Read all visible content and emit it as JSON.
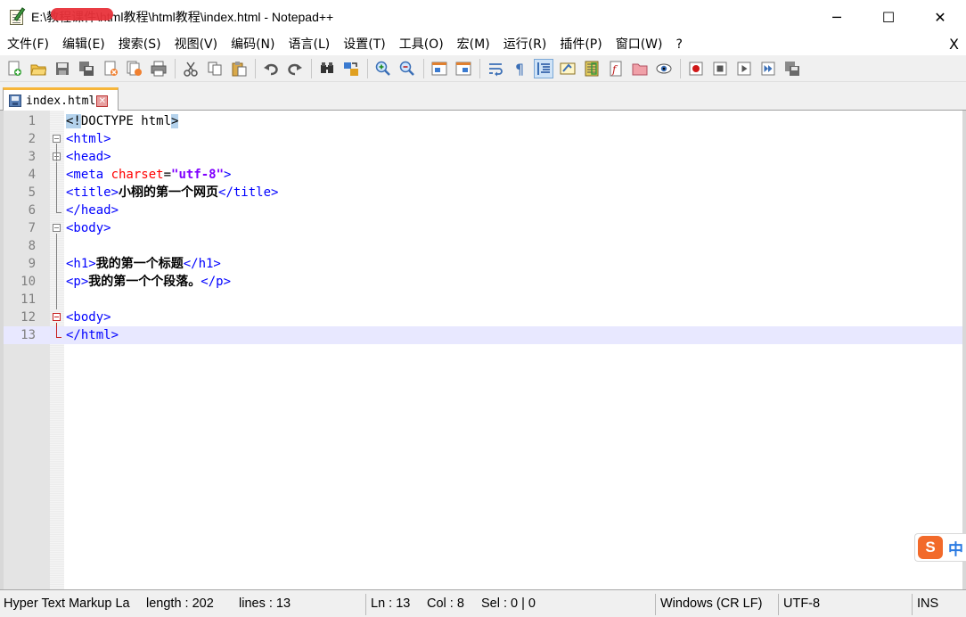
{
  "window": {
    "title": "E:\\教程课件\\html教程\\html教程\\index.html - Notepad++",
    "minimize": "─",
    "maximize": "☐",
    "close": "✕"
  },
  "menu": {
    "items": [
      "文件(F)",
      "编辑(E)",
      "搜索(S)",
      "视图(V)",
      "编码(N)",
      "语言(L)",
      "设置(T)",
      "工具(O)",
      "宏(M)",
      "运行(R)",
      "插件(P)",
      "窗口(W)",
      "?"
    ],
    "close": "X"
  },
  "tab": {
    "label": "index.html",
    "close": "✕"
  },
  "editor": {
    "lines": [
      {
        "n": "1",
        "tokens": [
          [
            "hl",
            "<!"
          ],
          [
            "plain",
            "DOCTYPE html"
          ],
          [
            "hl",
            ">"
          ]
        ]
      },
      {
        "n": "2",
        "tokens": [
          [
            "tag",
            "<html>"
          ]
        ]
      },
      {
        "n": "3",
        "tokens": [
          [
            "tag",
            "<head>"
          ]
        ]
      },
      {
        "n": "4",
        "tokens": [
          [
            "tag",
            "<meta "
          ],
          [
            "attr",
            "charset"
          ],
          [
            "plain",
            "="
          ],
          [
            "val",
            "\"utf-8\""
          ],
          [
            "tag",
            ">"
          ]
        ]
      },
      {
        "n": "5",
        "tokens": [
          [
            "tag",
            "<title>"
          ],
          [
            "txt",
            "小栩的第一个网页"
          ],
          [
            "tag",
            "</title>"
          ]
        ]
      },
      {
        "n": "6",
        "tokens": [
          [
            "tag",
            "</head>"
          ]
        ]
      },
      {
        "n": "7",
        "tokens": [
          [
            "tag",
            "<body>"
          ]
        ]
      },
      {
        "n": "8",
        "tokens": []
      },
      {
        "n": "9",
        "tokens": [
          [
            "tag",
            "<h1>"
          ],
          [
            "txt",
            "我的第一个标题"
          ],
          [
            "tag",
            "</h1>"
          ]
        ]
      },
      {
        "n": "10",
        "tokens": [
          [
            "tag",
            "<p>"
          ],
          [
            "txt",
            "我的第一个个段落。"
          ],
          [
            "tag",
            "</p>"
          ]
        ]
      },
      {
        "n": "11",
        "tokens": []
      },
      {
        "n": "12",
        "tokens": [
          [
            "tag",
            "<body>"
          ]
        ]
      },
      {
        "n": "13",
        "tokens": [
          [
            "tag",
            "</html>"
          ]
        ]
      }
    ],
    "current_line": 13
  },
  "ime": {
    "logo": "S",
    "mode": "中"
  },
  "status": {
    "language": "Hyper Text Markup La",
    "length": "length : 202",
    "lines": "lines : 13",
    "ln": "Ln : 13",
    "col": "Col : 8",
    "sel": "Sel : 0 | 0",
    "eol": "Windows (CR LF)",
    "encoding": "UTF-8",
    "mode": "INS"
  }
}
